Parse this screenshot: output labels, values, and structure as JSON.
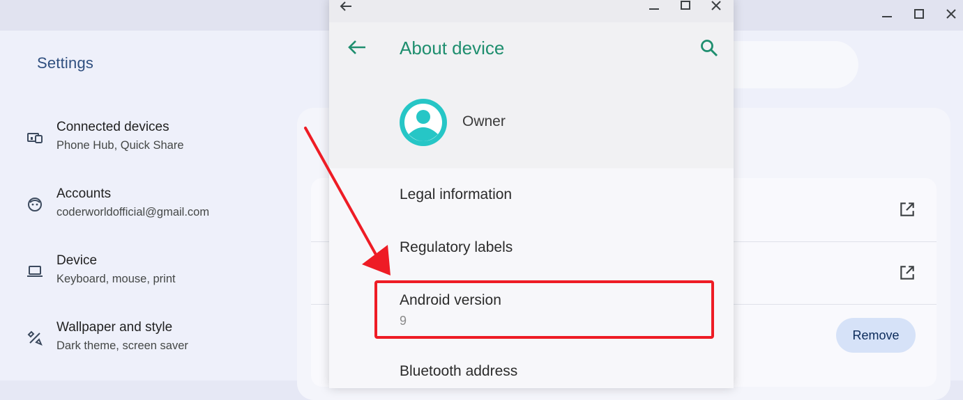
{
  "settings": {
    "title": "Settings",
    "nav": [
      {
        "title": "Connected devices",
        "subtitle": "Phone Hub, Quick Share",
        "icon": "connected-devices-icon"
      },
      {
        "title": "Accounts",
        "subtitle": "coderworldofficial@gmail.com",
        "icon": "account-face-icon"
      },
      {
        "title": "Device",
        "subtitle": "Keyboard, mouse, print",
        "icon": "laptop-icon"
      },
      {
        "title": "Wallpaper and style",
        "subtitle": "Dark theme, screen saver",
        "icon": "palette-brush-icon"
      }
    ],
    "remove_label": "Remove"
  },
  "android_window": {
    "title": "About device",
    "owner": "Owner",
    "items": [
      {
        "title": "Legal information"
      },
      {
        "title": "Regulatory labels"
      },
      {
        "title": "Android version",
        "subtitle": "9"
      },
      {
        "title": "Bluetooth address"
      }
    ]
  },
  "colors": {
    "accent_green": "#1e8e6e",
    "avatar_teal": "#26c6c6",
    "annotation_red": "#ee1c25",
    "settings_title_blue": "#2f4f7f"
  }
}
